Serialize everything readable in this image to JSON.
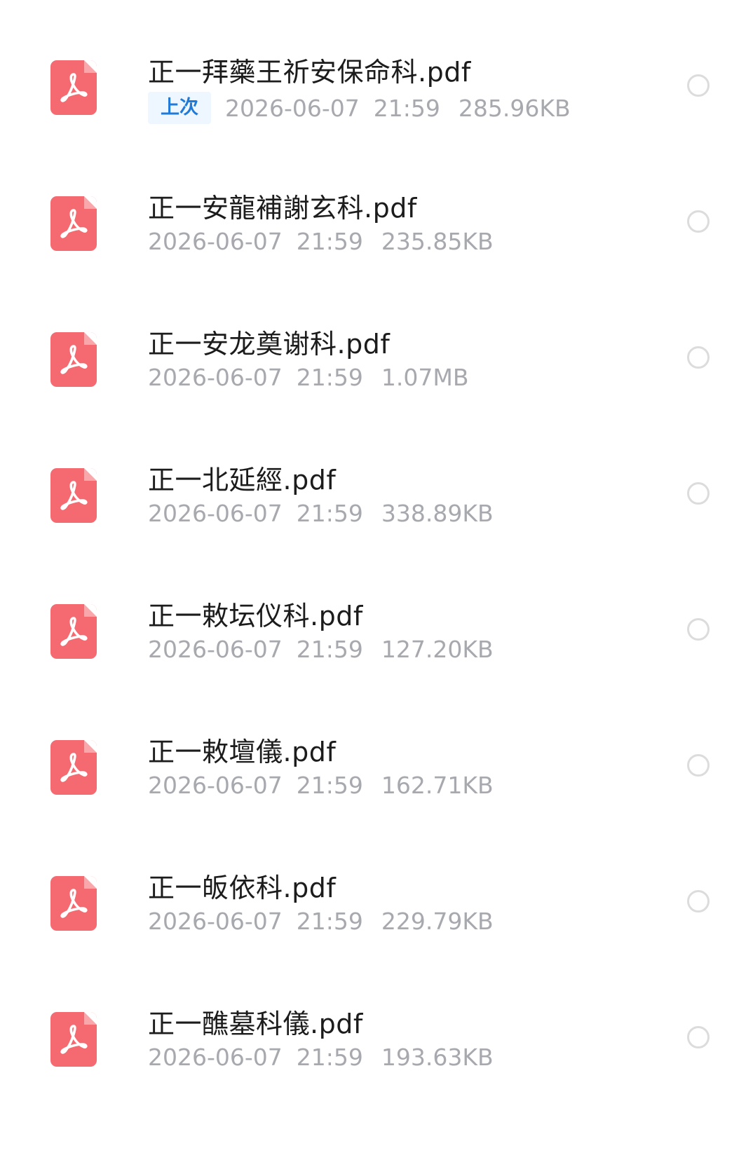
{
  "files": [
    {
      "name": "正一拜藥王祈安保命科.pdf",
      "badge": "上次",
      "date": "2026-06-07",
      "time": "21:59",
      "size": "285.96KB"
    },
    {
      "name": "正一安龍補謝玄科.pdf",
      "date": "2026-06-07",
      "time": "21:59",
      "size": "235.85KB"
    },
    {
      "name": "正一安龙奠谢科.pdf",
      "date": "2026-06-07",
      "time": "21:59",
      "size": "1.07MB"
    },
    {
      "name": "正一北延經.pdf",
      "date": "2026-06-07",
      "time": "21:59",
      "size": "338.89KB"
    },
    {
      "name": "正一敕坛仪科.pdf",
      "date": "2026-06-07",
      "time": "21:59",
      "size": "127.20KB"
    },
    {
      "name": "正一敕壇儀.pdf",
      "date": "2026-06-07",
      "time": "21:59",
      "size": "162.71KB"
    },
    {
      "name": "正一皈依科.pdf",
      "date": "2026-06-07",
      "time": "21:59",
      "size": "229.79KB"
    },
    {
      "name": "正一醮墓科儀.pdf",
      "date": "2026-06-07",
      "time": "21:59",
      "size": "193.63KB"
    }
  ],
  "icons": {
    "file_icon": "pdf-file-icon",
    "select_icon": "radio-unchecked-icon"
  },
  "colors": {
    "pdf_icon": "#f46a70",
    "badge_text": "#1f7ad8",
    "badge_bg": "#eef6ff",
    "meta_text": "#a7a9ae",
    "title_text": "#1c1c1c"
  }
}
